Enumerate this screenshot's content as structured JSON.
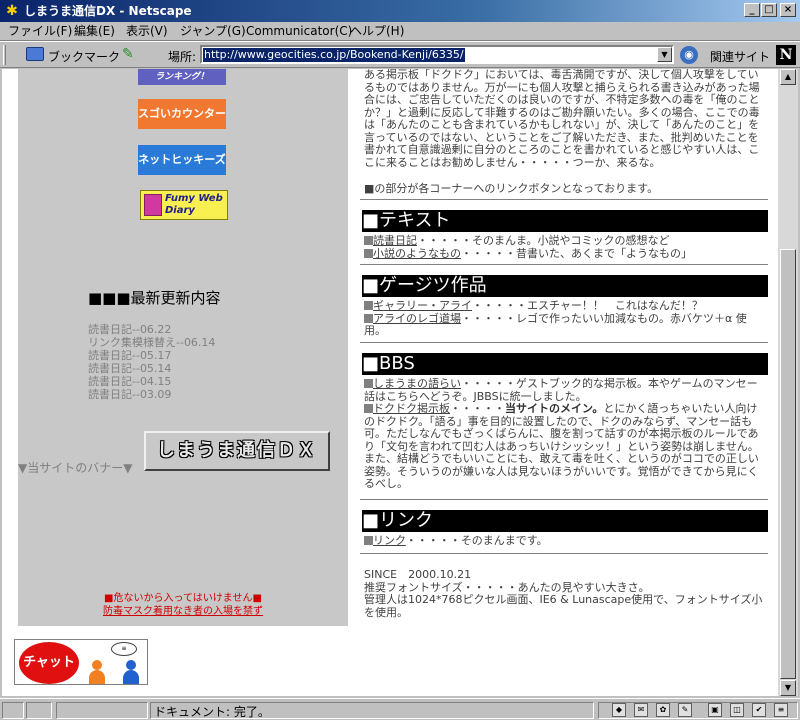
{
  "window": {
    "title": "しまうま通信DX - Netscape",
    "minimize": "_",
    "maximize": "□",
    "close": "×"
  },
  "menu": [
    "ファイル(F)",
    "編集(E)",
    "表示(V)",
    "ジャンプ(G)",
    "Communicator(C)",
    "ヘルプ(H)"
  ],
  "location": {
    "bookmark_label": "ブックマーク",
    "location_label": "場所:",
    "url": "http://www.geocities.co.jp/Bookend-Kenji/6335/",
    "related_label": "関連サイト",
    "netscape_logo": "N"
  },
  "sidebar": {
    "rank_banner": "ランキング！",
    "counter_button": "スゴいカウンター",
    "hikkies_button": "ネットヒッキーズ",
    "fumy_button": "Fumy Web Diary",
    "latest_heading": "■■■最新更新内容",
    "latest_items": [
      "読書日記--06.22",
      "リンク集模様替え--06.14",
      "読書日記--05.17",
      "読書日記--05.14",
      "読書日記--04.15",
      "読書日記--03.09"
    ],
    "banner_label": "▼当サイトのバナー▼",
    "banner_text": "しまうま通信ＤＸ",
    "warning_1": "■危ないから入ってはいけません■",
    "warning_2": "防毒マスク着用なき者の入場を禁ず",
    "chat_label": "チャット"
  },
  "main": {
    "intro": "ある掲示板「ドクドク」においては、毒舌満開ですが、決して個人攻撃をしているものではありません。万が一にも個人攻撃と捕らえられる書き込みがあった場合には、ご忠告していただくのは良いのですが、不特定多数への毒を「俺のことか？」と過剰に反応して非難するのはご勘弁願いたい。多くの場合、ここでの毒は「あんたのことも含まれているかもしれない」が、決して「あんたのこと」を言っているのではない、ということをご了解いただき、また、批判めいたことを書かれて自意識過剰に自分のところのことを書かれていると感じやすい人は、ここに来ることはお勧めしません・・・・・つーか、来るな。",
    "note": "■の部分が各コーナーへのリンクボタンとなっております。",
    "sections": {
      "text": {
        "heading": "■テキスト",
        "item1_link": "読書日記",
        "item1_desc": "・・・・・そのまんま。小説やコミックの感想など",
        "item2_link": "小説のようなもの",
        "item2_desc": "・・・・・昔書いた、あくまで「ようなもの」"
      },
      "art": {
        "heading": "■ゲージツ作品",
        "item1_link": "ギャラリー・アライ",
        "item1_desc": "・・・・・エスチャー！！　これはなんだ！？",
        "item2_link": "アライのレゴ道場",
        "item2_desc": "・・・・・レゴで作ったいい加減なもの。赤バケツ＋α 使用。"
      },
      "bbs": {
        "heading": "■BBS",
        "item1_link": "しまうまの語らい",
        "item1_desc": "・・・・・ゲストブック的な掲示板。本やゲームのマンセー話はこちらへどうぞ。JBBSに統一しました。",
        "item2_link": "ドクドク掲示板",
        "item2_mid": "・・・・・",
        "item2_bold": "当サイトのメイン。",
        "item2_desc": "とにかく語っちゃいたい人向けのドクドク。「語る」事を目的に設置したので、ドクのみならず、マンセー話も可。ただしなんでもざっくばらんに、腹を割って話すのが本掲示板のルールであり「文句を言われて凹む人はあっちいけシッシッ！」という姿勢は崩しません。また、結構どうでもいいことにも、敢えて毒を吐く、というのがココでの正しい姿勢。そういうのが嫌いな人は見ないほうがいいです。覚悟ができてから見にくるべし。"
      },
      "link": {
        "heading": "■リンク",
        "item1_link": "リンク",
        "item1_desc": "・・・・・そのまんまです。"
      }
    },
    "since": "SINCE　2000.10.21",
    "font_note": "推奨フォントサイズ・・・・・あんたの見やすい大きさ。",
    "env_note": "管理人は1024*768ピクセル画面、IE6 & Lunascape使用で、フォントサイズ小を使用。"
  },
  "status": {
    "text": "ドキュメント: 完了。"
  }
}
